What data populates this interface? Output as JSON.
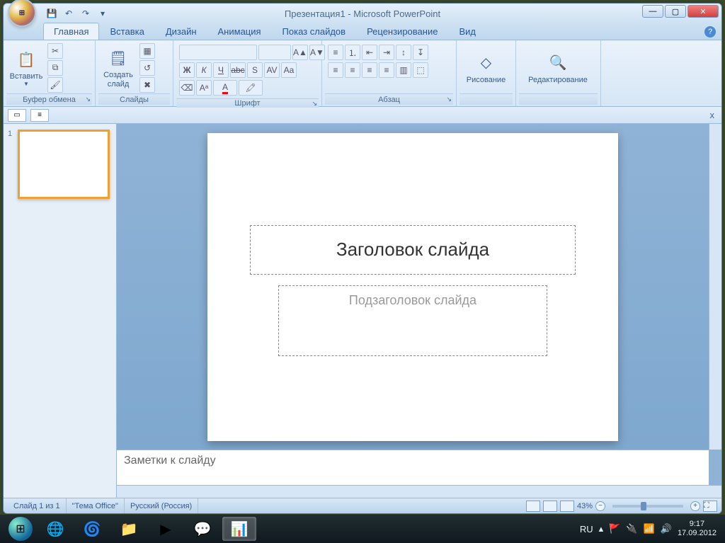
{
  "window": {
    "title": "Презентация1 - Microsoft PowerPoint"
  },
  "qat": {
    "save": "💾",
    "undo": "↶",
    "redo": "↷"
  },
  "tabs": {
    "home": "Главная",
    "insert": "Вставка",
    "design": "Дизайн",
    "animations": "Анимация",
    "slideshow": "Показ слайдов",
    "review": "Рецензирование",
    "view": "Вид"
  },
  "ribbon": {
    "clipboard": {
      "label": "Буфер обмена",
      "paste": "Вставить"
    },
    "slides": {
      "label": "Слайды",
      "new_slide": "Создать\nслайд"
    },
    "font": {
      "label": "Шрифт"
    },
    "paragraph": {
      "label": "Абзац"
    },
    "drawing": {
      "label": "",
      "btn": "Рисование"
    },
    "editing": {
      "label": "",
      "btn": "Редактирование"
    }
  },
  "panes": {
    "close": "x"
  },
  "thumb": {
    "num": "1"
  },
  "slide": {
    "title_placeholder": "Заголовок слайда",
    "subtitle_placeholder": "Подзаголовок слайда"
  },
  "notes": {
    "placeholder": "Заметки к слайду"
  },
  "status": {
    "slide_counter": "Слайд 1 из 1",
    "theme": "\"Тема Office\"",
    "language": "Русский (Россия)",
    "zoom": "43%"
  },
  "taskbar": {
    "lang": "RU",
    "time": "9:17",
    "date": "17.09.2012"
  }
}
